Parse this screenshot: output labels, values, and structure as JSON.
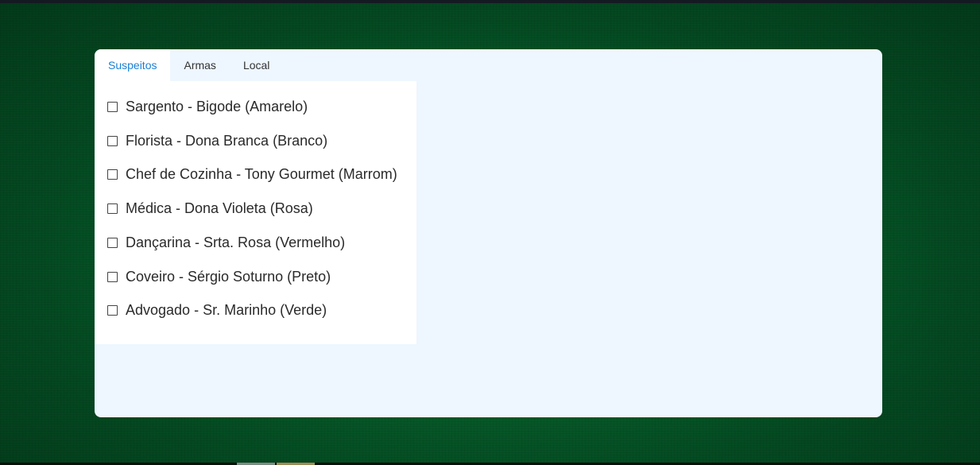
{
  "tabs": [
    {
      "label": "Suspeitos",
      "active": true
    },
    {
      "label": "Armas",
      "active": false
    },
    {
      "label": "Local",
      "active": false
    }
  ],
  "suspects": [
    {
      "label": "Sargento - Bigode (Amarelo)",
      "checked": false
    },
    {
      "label": "Florista - Dona Branca (Branco)",
      "checked": false
    },
    {
      "label": "Chef de Cozinha - Tony Gourmet (Marrom)",
      "checked": false
    },
    {
      "label": "Médica - Dona Violeta (Rosa)",
      "checked": false
    },
    {
      "label": "Dançarina - Srta. Rosa (Vermelho)",
      "checked": false
    },
    {
      "label": "Coveiro - Sérgio Soturno (Preto)",
      "checked": false
    },
    {
      "label": "Advogado - Sr. Marinho (Verde)",
      "checked": false
    }
  ],
  "colors": {
    "accent": "#1a7fd4",
    "panel_background": "#eef6ff",
    "page_background": "#075f2c"
  }
}
